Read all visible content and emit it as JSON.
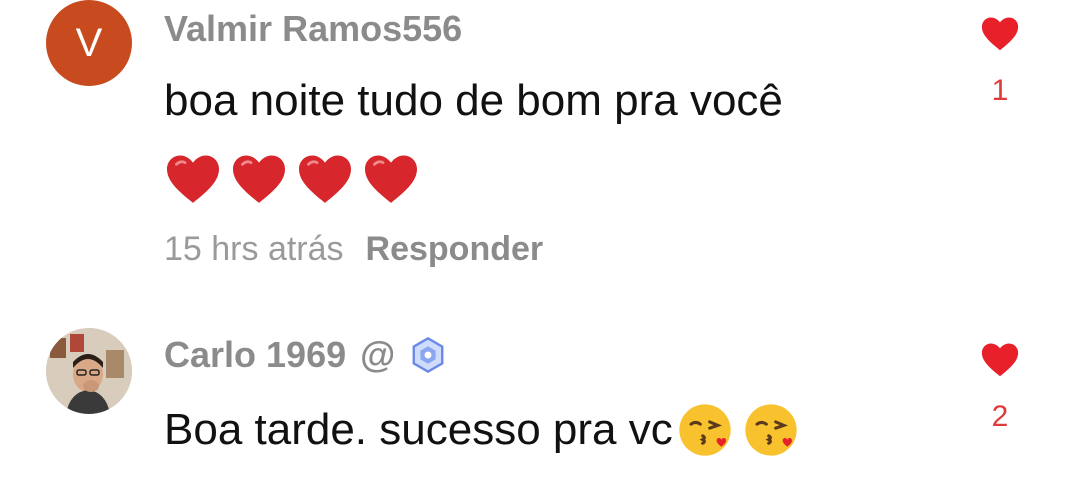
{
  "comments": [
    {
      "avatar_letter": "V",
      "avatar_color": "#c84a1f",
      "username": "Valmir Ramos556",
      "text": "boa noite tudo de bom pra você",
      "emoji_row": [
        "red-heart",
        "red-heart",
        "red-heart",
        "red-heart"
      ],
      "time": "15 hrs atrás",
      "reply_label": "Responder",
      "likes": "1"
    },
    {
      "avatar_icon": "user-photo",
      "username": "Carlo 1969",
      "mention_symbol": "@",
      "badge_icon": "verified-badge-icon",
      "text": "Boa tarde. sucesso pra vc",
      "emoji_suffix": [
        "kissing-face",
        "kissing-face"
      ],
      "likes": "2"
    }
  ],
  "colors": {
    "like_red": "#e03a3a",
    "username_gray": "#8b8b8b",
    "meta_gray": "#9a9a9a",
    "text_black": "#111111",
    "badge_blue": "#6a88e8"
  }
}
